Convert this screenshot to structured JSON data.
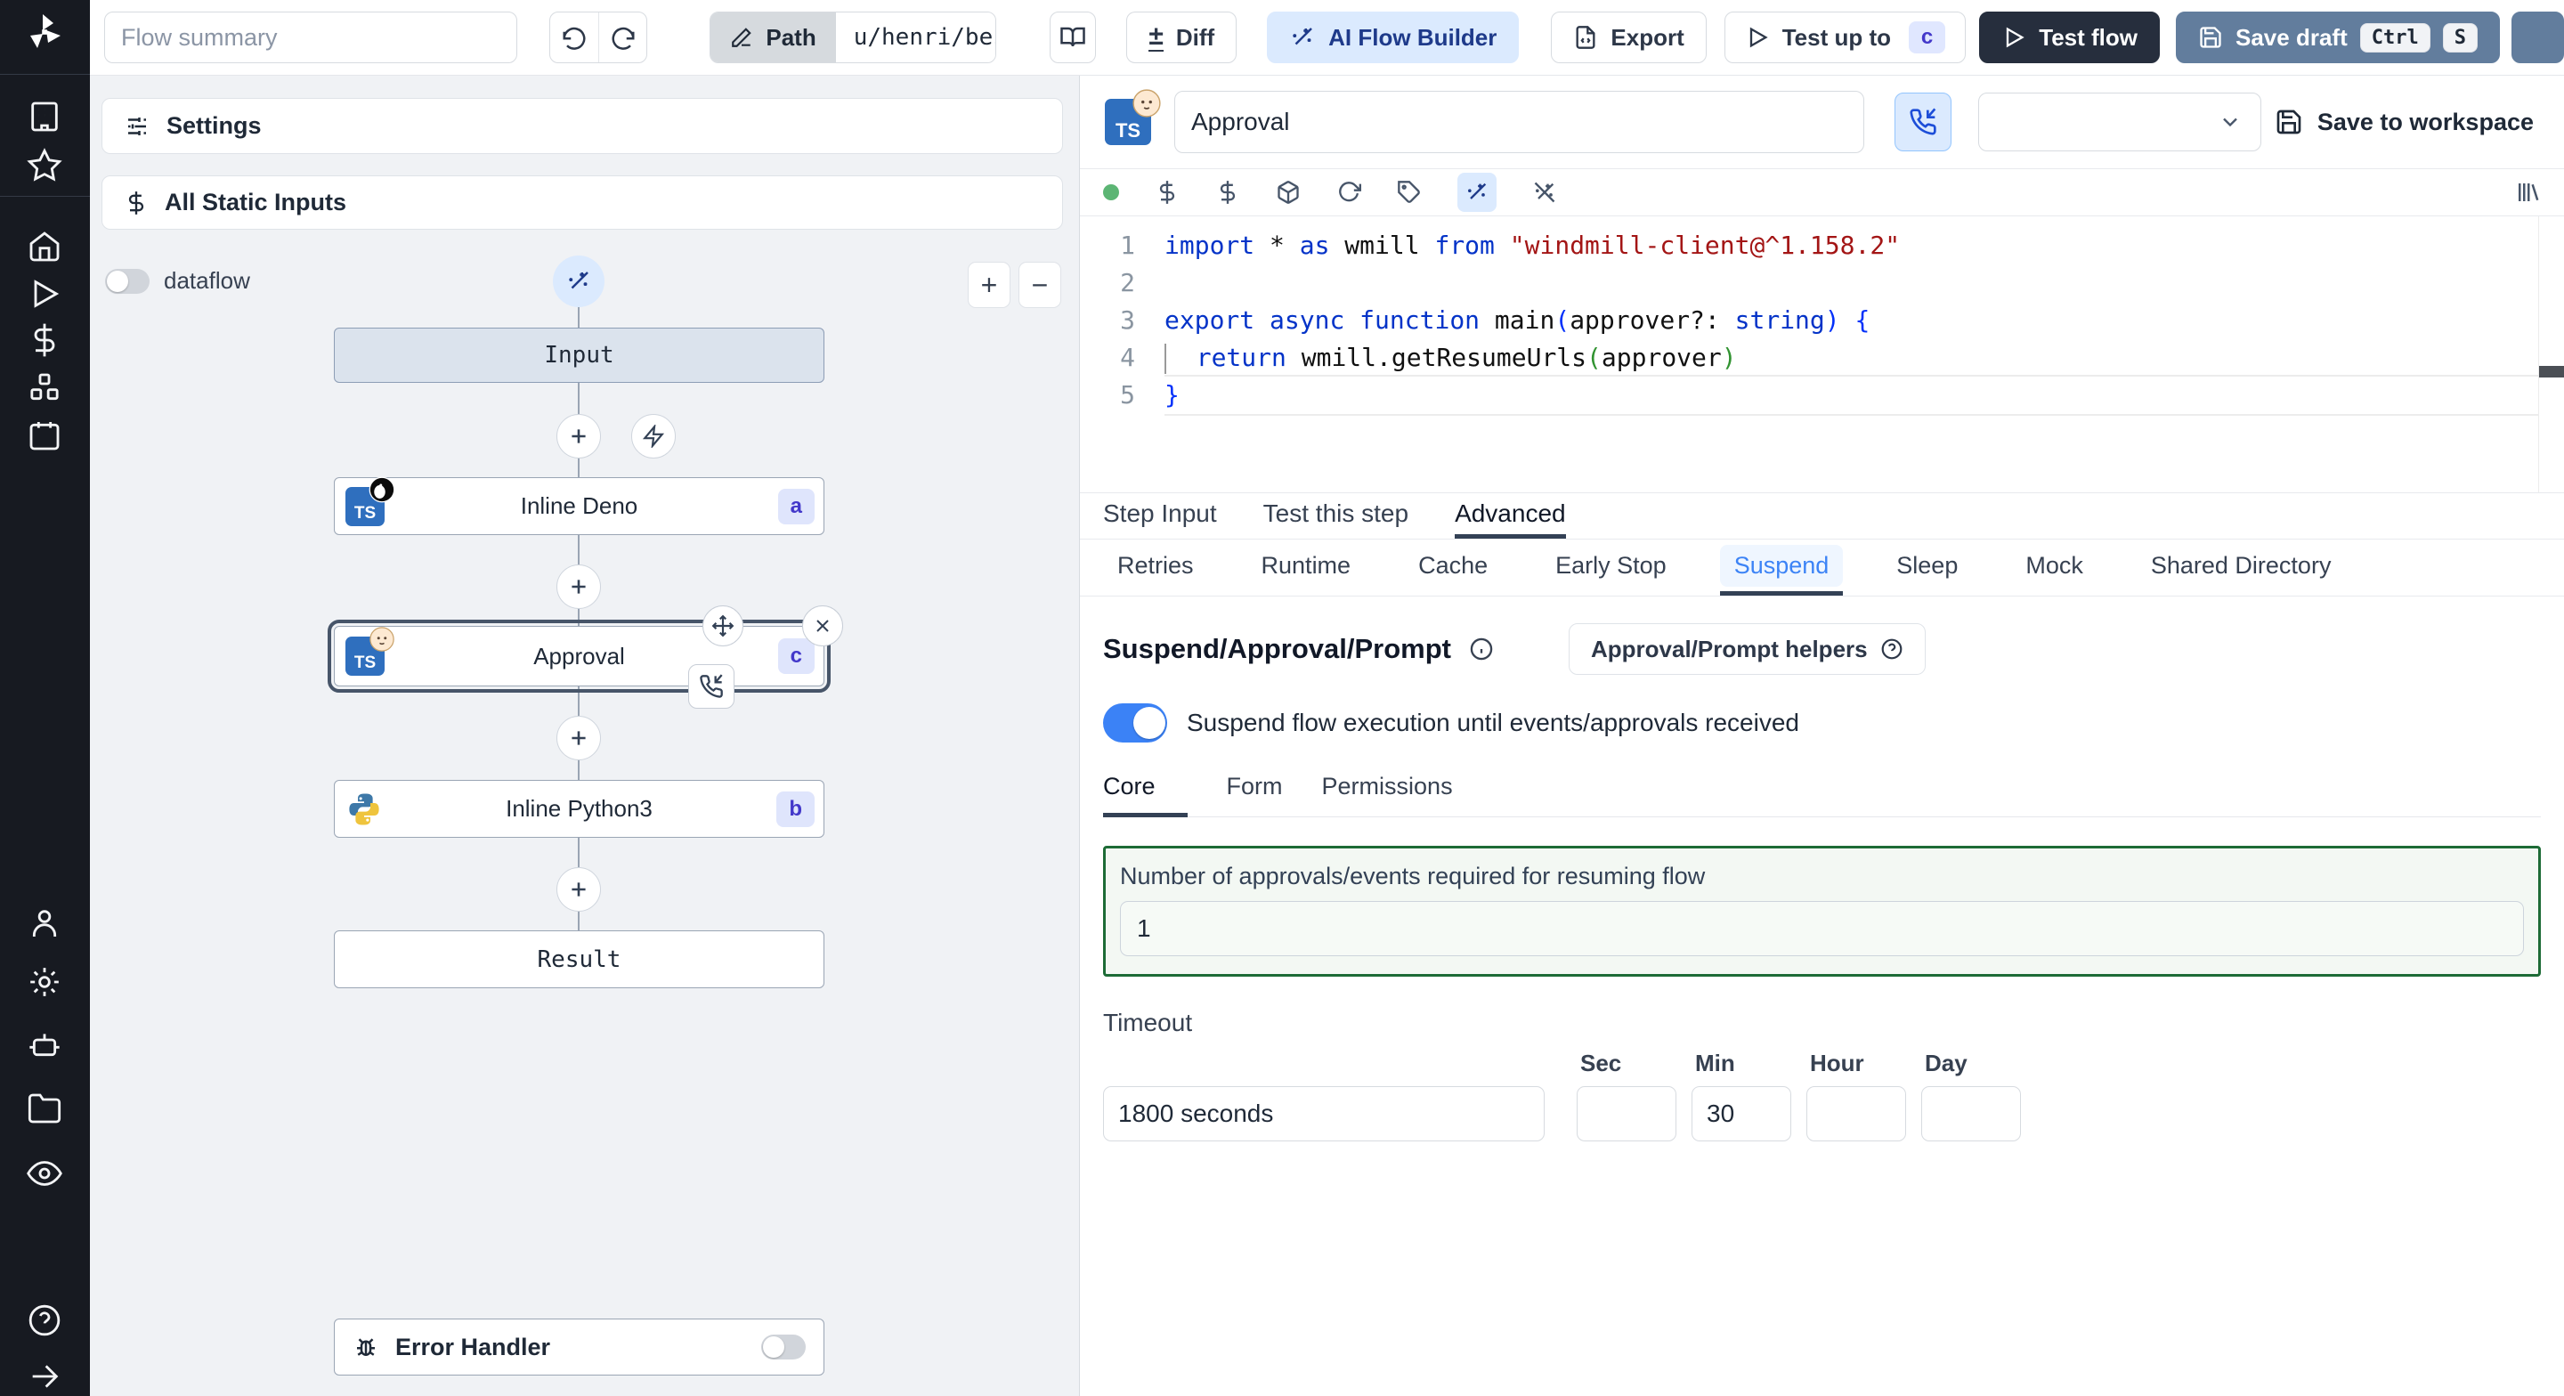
{
  "colors": {
    "accent": "#3b82f6",
    "badge_bg": "#e0e7ff",
    "badge_text": "#4338ca",
    "selected_node_ring": "#475569",
    "suspend_active_text": "#3c83f6",
    "green_box_border": "#1d6b36",
    "save_draft_bg": "#627d9d",
    "test_flow_bg": "#262e3d",
    "ai_builder_bg": "#dbeafe",
    "status_dot": "#5cb574"
  },
  "topbar": {
    "flow_summary_placeholder": "Flow summary",
    "path_label": "Path",
    "path_value": "u/henri/bes",
    "diff_sign": "±",
    "diff_label": "Diff",
    "ai_flow_builder_label": "AI Flow Builder",
    "export_label": "Export",
    "test_up_to_label": "Test up to",
    "test_up_to_badge": "c",
    "test_flow_label": "Test flow",
    "save_draft_label": "Save draft",
    "kbd_ctrl": "Ctrl",
    "kbd_s": "S"
  },
  "flow_panel": {
    "settings_label": "Settings",
    "static_inputs_label": "All Static Inputs",
    "dataflow_label": "dataflow",
    "zoom_in_label": "+",
    "zoom_out_label": "−",
    "ts_icon_label": "TS",
    "input_node_label": "Input",
    "deno_node_label": "Inline Deno",
    "deno_badge": "a",
    "approval_node_label": "Approval",
    "approval_badge": "c",
    "python_node_label": "Inline Python3",
    "python_badge": "b",
    "result_node_label": "Result",
    "error_handler_label": "Error Handler"
  },
  "step_panel": {
    "name_value": "Approval",
    "save_to_workspace_label": "Save to workspace",
    "tabs": [
      "Step Input",
      "Test this step",
      "Advanced"
    ],
    "subtabs": [
      "Retries",
      "Runtime",
      "Cache",
      "Early Stop",
      "Suspend",
      "Sleep",
      "Mock",
      "Shared Directory"
    ],
    "editor": {
      "line_numbers": [
        "1",
        "2",
        "3",
        "4",
        "5"
      ],
      "lines": [
        [
          {
            "c": "kw",
            "t": "import"
          },
          {
            "c": "pl",
            "t": " * "
          },
          {
            "c": "kw",
            "t": "as"
          },
          {
            "c": "pl",
            "t": " wmill "
          },
          {
            "c": "kw",
            "t": "from"
          },
          {
            "c": "pl",
            "t": " "
          },
          {
            "c": "str",
            "t": "\"windmill-client@^1.158.2\""
          }
        ],
        [],
        [
          {
            "c": "kw",
            "t": "export"
          },
          {
            "c": "pl",
            "t": " "
          },
          {
            "c": "kw",
            "t": "async"
          },
          {
            "c": "pl",
            "t": " "
          },
          {
            "c": "kw",
            "t": "function"
          },
          {
            "c": "pl",
            "t": " main"
          },
          {
            "c": "pb",
            "t": "("
          },
          {
            "c": "pl",
            "t": "approver?: "
          },
          {
            "c": "kw",
            "t": "string"
          },
          {
            "c": "pb",
            "t": ")"
          },
          {
            "c": "pl",
            "t": " "
          },
          {
            "c": "pb",
            "t": "{"
          }
        ],
        [
          {
            "c": "ig",
            "t": ""
          },
          {
            "c": "pl",
            "t": "  "
          },
          {
            "c": "kw",
            "t": "return"
          },
          {
            "c": "pl",
            "t": " wmill.getResumeUrls"
          },
          {
            "c": "pg",
            "t": "("
          },
          {
            "c": "pl",
            "t": "approver"
          },
          {
            "c": "pg",
            "t": ")"
          }
        ],
        [
          {
            "c": "pb",
            "t": "}"
          }
        ]
      ]
    },
    "suspend_section": {
      "heading": "Suspend/Approval/Prompt",
      "helpers_label": "Approval/Prompt helpers",
      "toggle_label": "Suspend flow execution until events/approvals received",
      "tabs": [
        "Core",
        "Form",
        "Permissions"
      ],
      "approvals_label": "Number of approvals/events required for resuming flow",
      "approvals_value": "1",
      "timeout_label": "Timeout",
      "timeout_value": "1800 seconds",
      "unit_labels": [
        "Sec",
        "Min",
        "Hour",
        "Day"
      ],
      "sec_value": "",
      "min_value": "30",
      "hour_value": "",
      "day_value": ""
    }
  }
}
